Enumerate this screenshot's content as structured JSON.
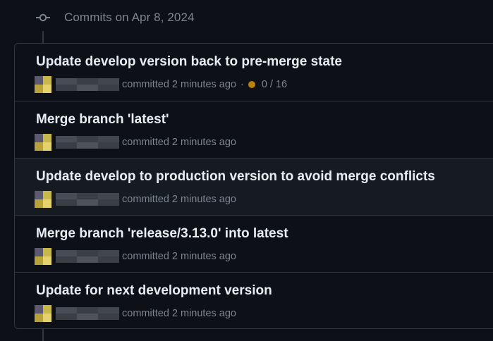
{
  "header": {
    "icon": "git-commit-icon",
    "date_label": "Commits on Apr 8, 2024"
  },
  "commits": [
    {
      "title": "Update develop version back to pre-merge state",
      "meta": "committed 2 minutes ago",
      "separator": "·",
      "checks": "0 / 16",
      "check_color": "#bb8009"
    },
    {
      "title": "Merge branch 'latest'",
      "meta": "committed 2 minutes ago"
    },
    {
      "title": "Update develop to production version to avoid merge conflicts",
      "meta": "committed 2 minutes ago"
    },
    {
      "title": "Merge branch 'release/3.13.0' into latest",
      "meta": "committed 2 minutes ago"
    },
    {
      "title": "Update for next development version",
      "meta": "committed 2 minutes ago"
    }
  ],
  "colors": {
    "background": "#0d1117",
    "row_highlight": "#161b22",
    "border": "#30363d",
    "muted_text": "#7d8590",
    "title_text": "#e6edf3",
    "pending_status": "#bb8009"
  }
}
